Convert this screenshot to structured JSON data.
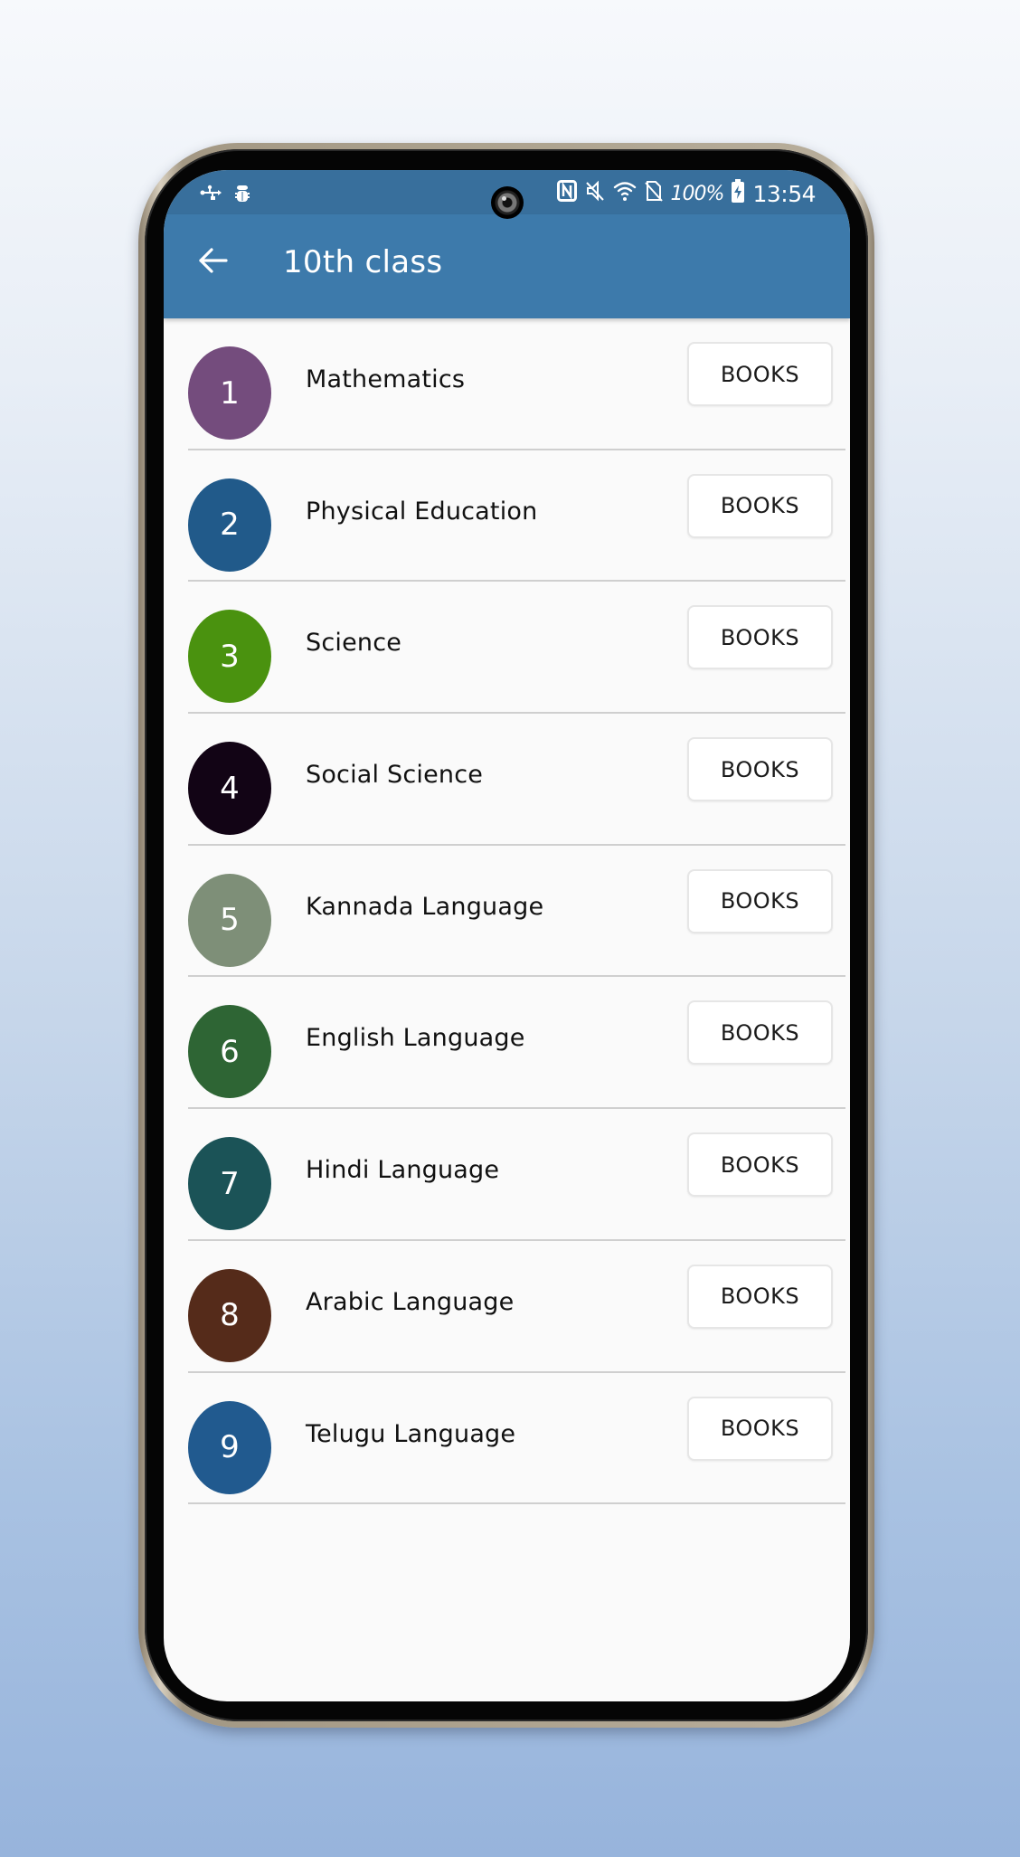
{
  "status_bar": {
    "left_icons": [
      "usb-icon",
      "debug-bug-icon"
    ],
    "right_icons": [
      "nfc-icon",
      "mute-icon",
      "wifi-icon",
      "no-sim-icon"
    ],
    "battery_percent": "100%",
    "time": "13:54"
  },
  "app_bar": {
    "back_icon": "arrow-left-icon",
    "title": "10th class"
  },
  "subjects": [
    {
      "number": "1",
      "name": "Mathematics",
      "button": "BOOKS",
      "color": "#744c7d"
    },
    {
      "number": "2",
      "name": "Physical Education",
      "button": "BOOKS",
      "color": "#215a8a"
    },
    {
      "number": "3",
      "name": "Science",
      "button": "BOOKS",
      "color": "#4a920f"
    },
    {
      "number": "4",
      "name": "Social Science",
      "button": "BOOKS",
      "color": "#120415"
    },
    {
      "number": "5",
      "name": "Kannada Language",
      "button": "BOOKS",
      "color": "#7e8f78"
    },
    {
      "number": "6",
      "name": "English Language",
      "button": "BOOKS",
      "color": "#2e6534"
    },
    {
      "number": "7",
      "name": "Hindi Language",
      "button": "BOOKS",
      "color": "#1b5357"
    },
    {
      "number": "8",
      "name": "Arabic Language",
      "button": "BOOKS",
      "color": "#552b1a"
    },
    {
      "number": "9",
      "name": "Telugu Language",
      "button": "BOOKS",
      "color": "#215a8f"
    }
  ]
}
